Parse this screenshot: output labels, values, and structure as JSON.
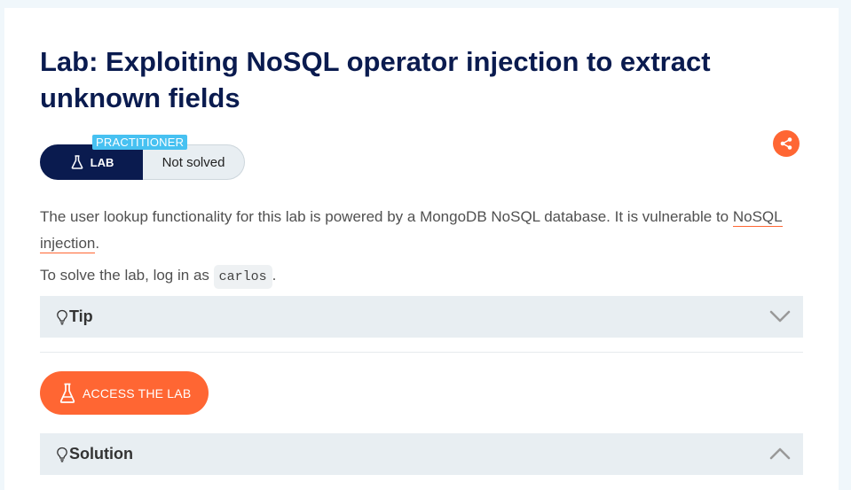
{
  "lab": {
    "title": "Lab: Exploiting NoSQL operator injection to extract unknown fields",
    "level": "PRACTITIONER",
    "lab_label": "LAB",
    "status": "Not solved"
  },
  "description": {
    "text": "The user lookup functionality for this lab is powered by a MongoDB NoSQL database. It is vulnerable to ",
    "link": "NoSQL injection",
    "end": "."
  },
  "task": {
    "prefix": "To solve the lab, log in as ",
    "username": "carlos",
    "suffix": "."
  },
  "tip": {
    "label": "Tip"
  },
  "access": {
    "label": "ACCESS THE LAB"
  },
  "solution": {
    "label": "Solution"
  },
  "colors": {
    "navy": "#0a1b4f",
    "accent": "#ff6633",
    "practitioner": "#47c1f1",
    "panel": "#e8eef2"
  },
  "icons": {
    "share": "share-icon",
    "lab": "flask-icon",
    "tip": "lightbulb-icon",
    "expand": "chevron-down-icon",
    "collapse": "chevron-up-icon"
  }
}
